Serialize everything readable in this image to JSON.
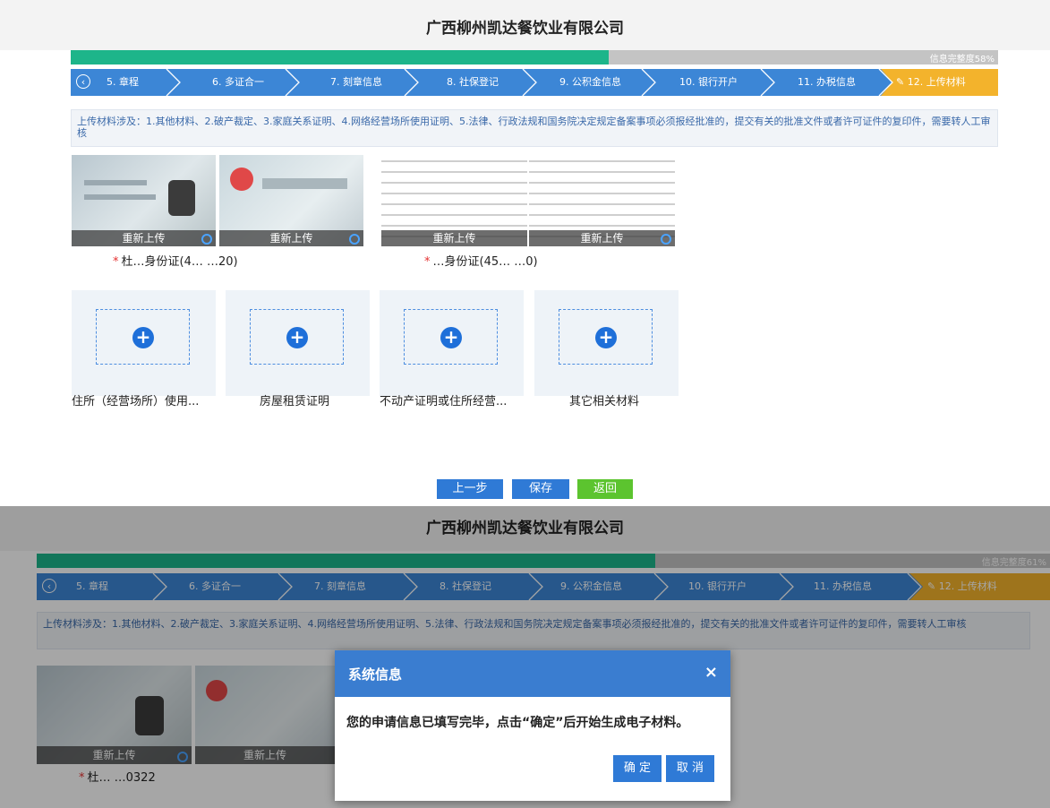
{
  "top": {
    "company_title": "广西柳州凯达餐饮业有限公司",
    "progress": {
      "value": 0.58,
      "label": "信息完整度58%"
    },
    "steps": [
      "5. 章程",
      "6. 多证合一",
      "7. 刻章信息",
      "8. 社保登记",
      "9. 公积金信息",
      "10. 银行开户",
      "11. 办税信息",
      "12. 上传材料"
    ],
    "active_step": "12. 上传材料",
    "notice": "上传材料涉及：1.其他材料、2.破产裁定、3.家庭关系证明、4.网络经营场所使用证明、5.法律、行政法规和国务院决定规定备案事项必须报经批准的，提交有关的批准文件或者许可证件的复印件，需要转人工审核",
    "reupload": "重新上传",
    "id_captions": [
      "杜…身份证(4…  …20)",
      "…身份证(45…  …0)"
    ],
    "upload_labels": [
      "住所（经营场所）使用...",
      "房屋租赁证明",
      "不动产证明或住所经营...",
      "其它相关材料"
    ],
    "buttons": {
      "prev": "上一步",
      "save": "保存",
      "back": "返回"
    }
  },
  "bottom": {
    "company_title": "广西柳州凯达餐饮业有限公司",
    "progress": {
      "value": 0.61,
      "label": "信息完整度61%"
    },
    "steps": [
      "5. 章程",
      "6. 多证合一",
      "7. 刻章信息",
      "8. 社保登记",
      "9. 公积金信息",
      "10. 银行开户",
      "11. 办税信息",
      "12. 上传材料"
    ],
    "notice": "上传材料涉及：1.其他材料、2.破产裁定、3.家庭关系证明、4.网络经营场所使用证明、5.法律、行政法规和国务院决定规定备案事项必须报经批准的，提交有关的批准文件或者许可证件的复印件，需要转人工审核",
    "reupload": "重新上传",
    "id_caption": "杜…  …0322",
    "dialog": {
      "title": "系统信息",
      "close": "×",
      "message": "您的申请信息已填写完毕，点击“确定”后开始生成电子材料。",
      "confirm": "确 定",
      "cancel": "取 消"
    }
  },
  "colors": {
    "accent": "#3c86d6",
    "progress": "#1db58a",
    "active_step": "#f3b32c",
    "save_button": "#2f7ad6",
    "back_button": "#5cc42f"
  }
}
